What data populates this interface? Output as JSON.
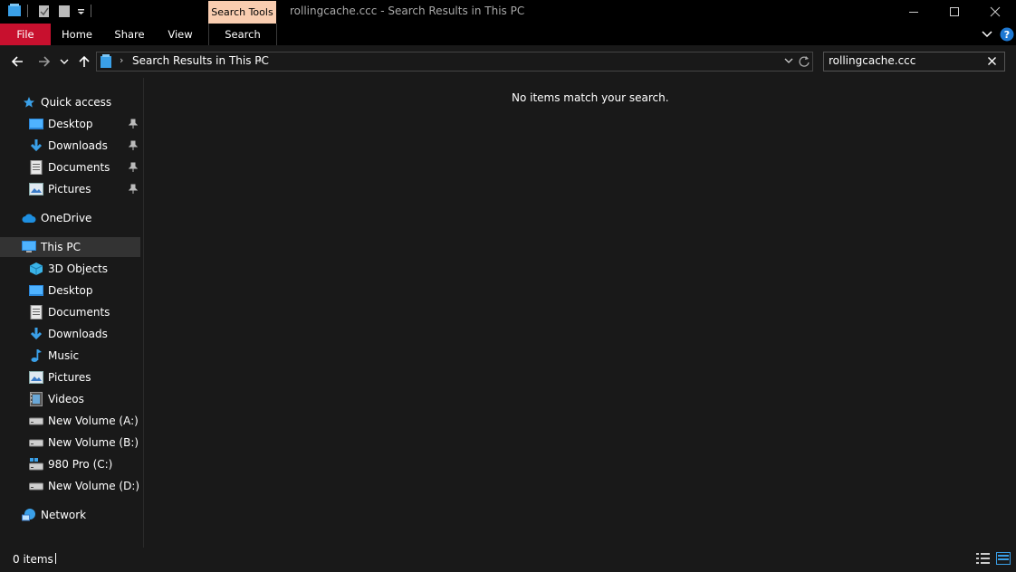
{
  "window": {
    "title": "rollingcache.ccc - Search Results in This PC",
    "contextual_tab": "Search Tools"
  },
  "ribbon": {
    "tabs": [
      "File",
      "Home",
      "Share",
      "View",
      "Search"
    ]
  },
  "address": {
    "path": "Search Results in This PC",
    "search_value": "rollingcache.ccc"
  },
  "sidebar": {
    "quick_access": {
      "label": "Quick access",
      "items": [
        "Desktop",
        "Downloads",
        "Documents",
        "Pictures"
      ]
    },
    "onedrive": "OneDrive",
    "this_pc": {
      "label": "This PC",
      "items": [
        "3D Objects",
        "Desktop",
        "Documents",
        "Downloads",
        "Music",
        "Pictures",
        "Videos",
        "New Volume (A:)",
        "New Volume (B:)",
        "980 Pro (C:)",
        "New Volume (D:)"
      ]
    },
    "network": "Network"
  },
  "content": {
    "empty_message": "No items match your search."
  },
  "status": {
    "item_count": "0 items"
  },
  "colors": {
    "file_tab": "#c8102e",
    "search_tools_tab": "#f9cdb0",
    "accent_blue": "#1e90ff"
  }
}
